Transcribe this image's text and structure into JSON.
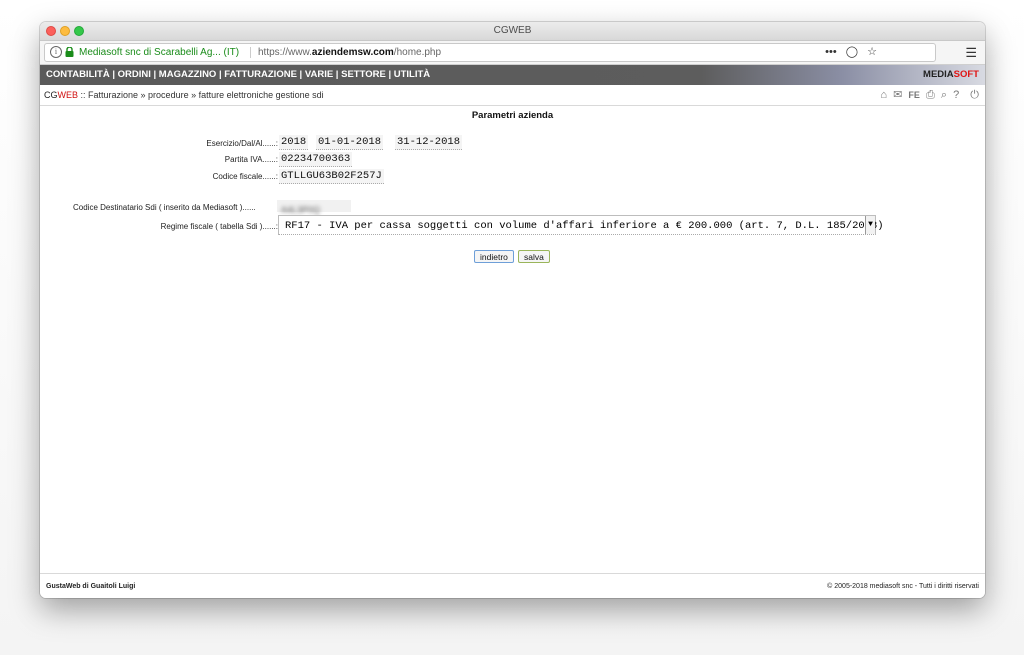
{
  "window": {
    "title": "CGWEB"
  },
  "browser": {
    "site_identity": "Mediasoft snc di Scarabelli Ag... (IT)",
    "url_prefix": "https://www.",
    "url_domain": "aziendemsw.com",
    "url_path": "/home.php",
    "actions": "•••"
  },
  "nav": {
    "items": "CONTABILITÀ | ORDINI | MAGAZZINO | FATTURAZIONE | VARIE | SETTORE | UTILITÀ",
    "brand_media": "MEDIA",
    "brand_soft": "SOFT"
  },
  "breadcrumb": {
    "cg": "CG",
    "web": "WEB",
    "path": " :: Fatturazione » procedure » fatture elettroniche gestione sdi"
  },
  "tools": {
    "fe": "FE",
    "help": "?"
  },
  "page": {
    "title": "Parametri azienda"
  },
  "form": {
    "esercizio_label": "Esercizio/Dal/Al......:",
    "esercizio_year": "2018",
    "esercizio_from": "01-01-2018",
    "esercizio_to": "31-12-2018",
    "piva_label": "Partita IVA......:",
    "piva_value": "02234700363",
    "cf_label": "Codice fiscale......:",
    "cf_value": "GTLLGU63B02F257J",
    "sdi_label": "Codice Destinatario Sdi ( inserito da Mediasoft )......",
    "sdi_value": "A4L3P0Q",
    "regime_label": "Regime fiscale ( tabella Sdi )......:",
    "regime_value": "RF17 - IVA per cassa soggetti con volume d'affari inferiore a € 200.000 (art. 7, D.L. 185/2008)"
  },
  "buttons": {
    "back": "indietro",
    "save": "salva"
  },
  "footer": {
    "left": "GustaWeb di Guaitoli Luigi",
    "right": "© 2005-2018 mediasoft snc - Tutti i diritti riservati"
  }
}
